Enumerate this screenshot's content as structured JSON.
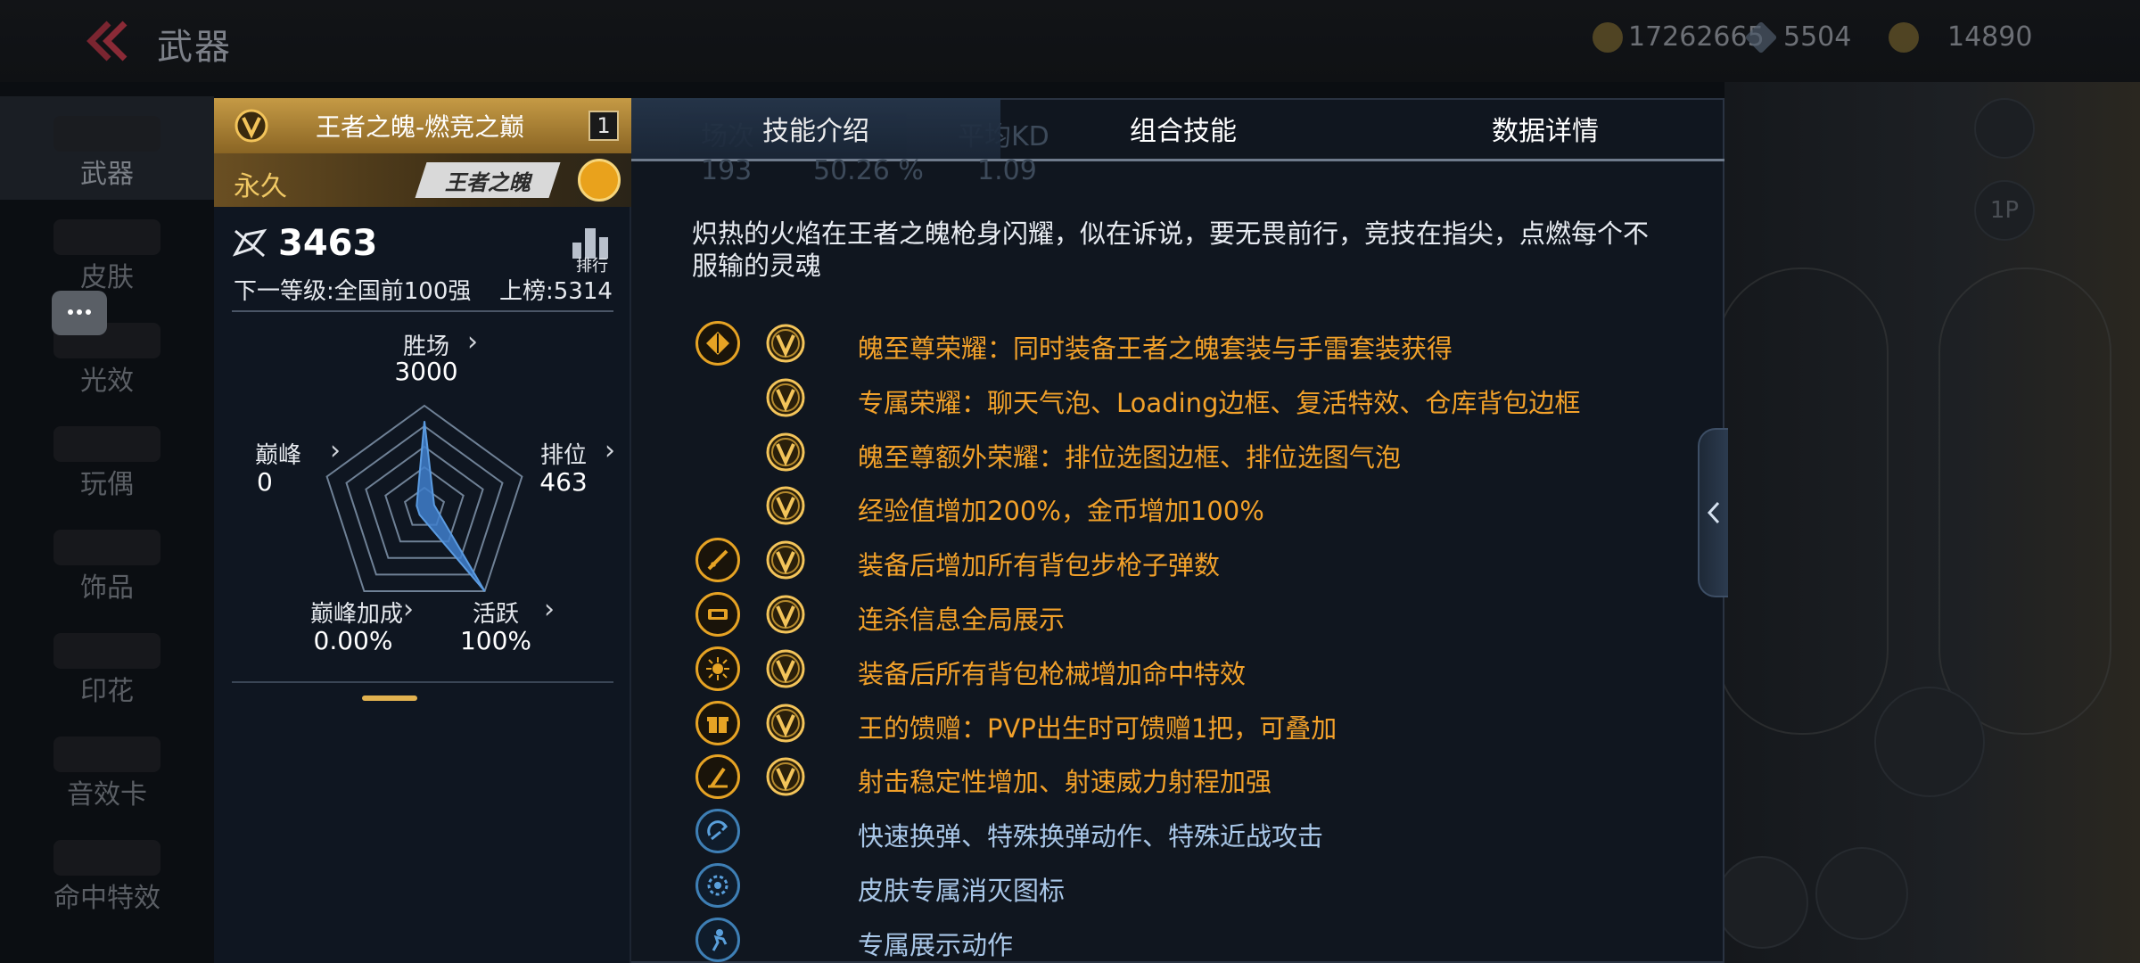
{
  "header": {
    "title": "武器",
    "currencies": [
      {
        "icon": "coin-icon",
        "value": "17262665"
      },
      {
        "icon": "diamond-icon",
        "value": "5504"
      },
      {
        "icon": "token-icon",
        "value": "14890"
      }
    ]
  },
  "sidebar": {
    "items": [
      {
        "label": "武器",
        "active": true
      },
      {
        "label": "皮肤"
      },
      {
        "label": "光效"
      },
      {
        "label": "玩偶"
      },
      {
        "label": "饰品"
      },
      {
        "label": "印花"
      },
      {
        "label": "音效卡"
      },
      {
        "label": "命中特效"
      }
    ]
  },
  "card": {
    "name": "王者之魄-燃竞之巅",
    "level": "1",
    "duration": "永久",
    "logo_text": "王者之魄",
    "score": "3463",
    "rank_icon_label": "排行",
    "next_level": "下一等级:全国前100强",
    "board_rank": "上榜:5314",
    "radar": {
      "wins_label": "胜场",
      "wins_value": "3000",
      "rank_label": "排位",
      "rank_value": "463",
      "active_label": "活跃",
      "active_value": "100%",
      "peak_bonus_label": "巅峰加成",
      "peak_bonus_value": "0.00%",
      "peak_label": "巅峰",
      "peak_value": "0",
      "levels": {
        "wins": 0.85,
        "rank": 0.1,
        "active": 1.0,
        "peak_bonus": 0.0,
        "peak": 0.0
      }
    }
  },
  "tabs": [
    {
      "label": "技能介绍",
      "active": true
    },
    {
      "label": "组合技能"
    },
    {
      "label": "数据详情"
    }
  ],
  "ghost_stats": {
    "label1": "场次",
    "value1": "193",
    "value2": "50.26 %",
    "label3": "平均KD",
    "value3": "1.09"
  },
  "description": "炽热的火焰在王者之魄枪身闪耀，似在诉说，要无畏前行，竞技在指尖，点燃每个不服输的灵魂",
  "skills": [
    {
      "icon": "diamond-emblem-icon",
      "badge": true,
      "color": "gold",
      "text": "魄至尊荣耀：同时装备王者之魄套装与手雷套装获得"
    },
    {
      "icon": "",
      "badge": true,
      "color": "gold",
      "text": "专属荣耀：聊天气泡、Loading边框、复活特效、仓库背包边框"
    },
    {
      "icon": "",
      "badge": true,
      "color": "gold",
      "text": "魄至尊额外荣耀：排位选图边框、排位选图气泡"
    },
    {
      "icon": "",
      "badge": true,
      "color": "gold",
      "text": "经验值增加200%，金币增加100%"
    },
    {
      "icon": "rifle-icon",
      "badge": true,
      "color": "gold",
      "text": "装备后增加所有背包步枪子弹数"
    },
    {
      "icon": "killfeed-icon",
      "badge": true,
      "color": "gold",
      "text": "连杀信息全局展示"
    },
    {
      "icon": "hit-effect-icon",
      "badge": true,
      "color": "gold",
      "text": "装备后所有背包枪械增加命中特效"
    },
    {
      "icon": "gift-icon",
      "badge": true,
      "color": "gold",
      "text": "王的馈赠：PVP出生时可馈赠1把，可叠加"
    },
    {
      "icon": "stability-icon",
      "badge": true,
      "color": "gold",
      "text": "射击稳定性增加、射速威力射程加强"
    },
    {
      "icon": "reload-icon",
      "badge": false,
      "color": "blue",
      "text": "快速换弹、特殊换弹动作、特殊近战攻击"
    },
    {
      "icon": "kill-icon",
      "badge": false,
      "color": "blue",
      "text": "皮肤专属消灭图标"
    },
    {
      "icon": "pose-icon",
      "badge": false,
      "color": "blue",
      "text": "专属展示动作"
    }
  ],
  "right_controls": {
    "view_label": "1P"
  }
}
